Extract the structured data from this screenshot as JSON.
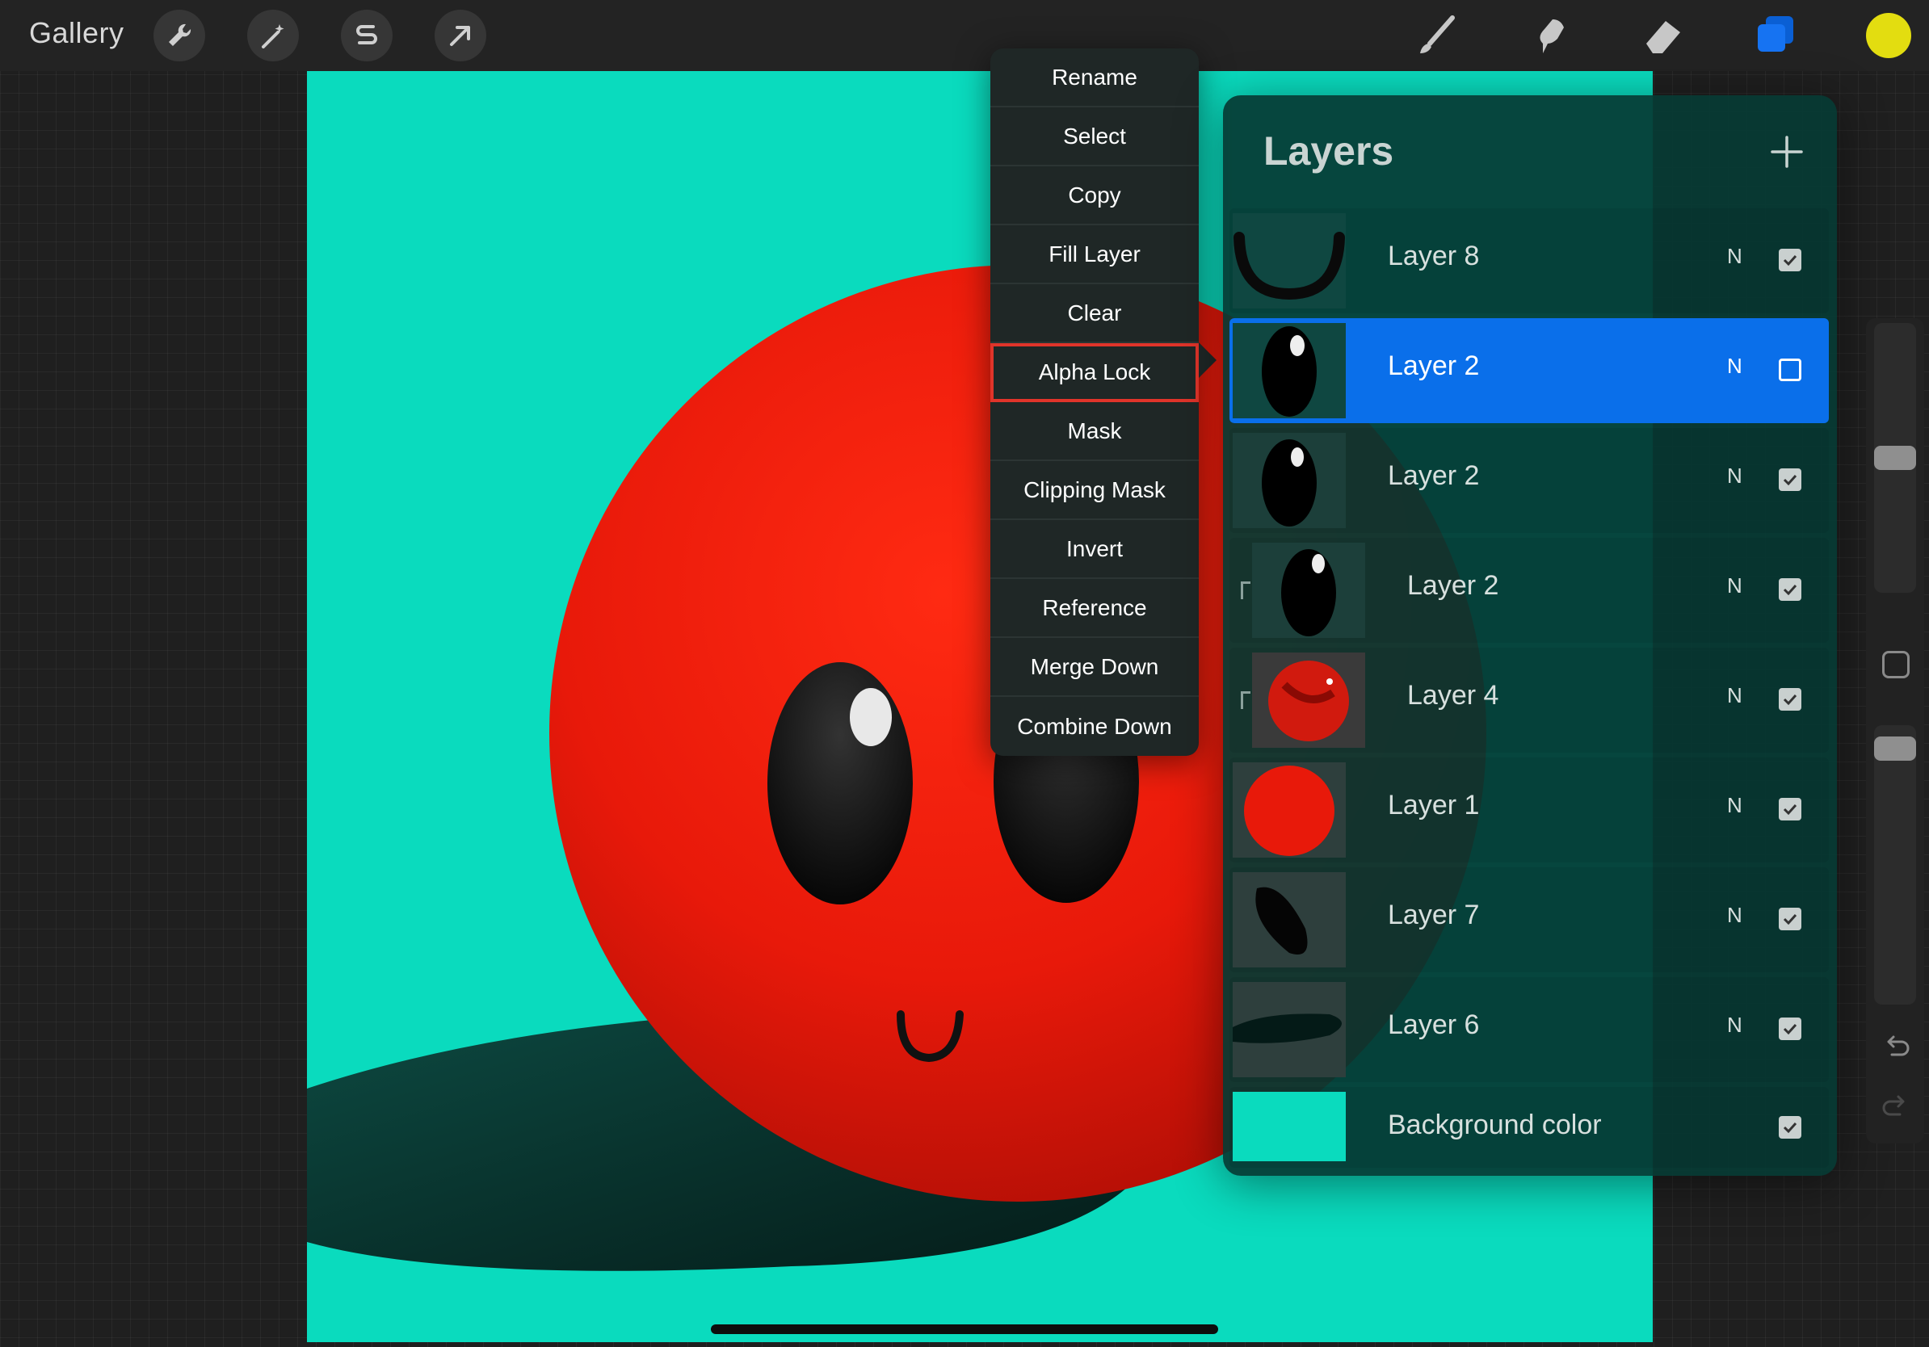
{
  "toolbar": {
    "gallery_label": "Gallery",
    "left_tools": [
      "wrench-icon",
      "magic-wand-icon",
      "selection-s-icon",
      "transform-arrow-icon"
    ],
    "right_tools": [
      "brush-icon",
      "smudge-icon",
      "eraser-icon",
      "layers-icon"
    ],
    "current_color": "#e3dd10"
  },
  "canvas": {
    "background": "#0adbbe",
    "subject": "red ball character with face and shadow"
  },
  "context_menu": {
    "items": [
      "Rename",
      "Select",
      "Copy",
      "Fill Layer",
      "Clear",
      "Alpha Lock",
      "Mask",
      "Clipping Mask",
      "Invert",
      "Reference",
      "Merge Down",
      "Combine Down"
    ],
    "highlighted": "Alpha Lock"
  },
  "layers_panel": {
    "title": "Layers",
    "layers": [
      {
        "name": "Layer 8",
        "blend": "N",
        "visible": true,
        "selected": false,
        "clipped": false,
        "thumb": "smile"
      },
      {
        "name": "Layer 2",
        "blend": "N",
        "visible": false,
        "selected": true,
        "clipped": false,
        "thumb": "eye"
      },
      {
        "name": "Layer 2",
        "blend": "N",
        "visible": true,
        "selected": false,
        "clipped": false,
        "thumb": "eye"
      },
      {
        "name": "Layer 2",
        "blend": "N",
        "visible": true,
        "selected": false,
        "clipped": true,
        "thumb": "eye"
      },
      {
        "name": "Layer 4",
        "blend": "N",
        "visible": true,
        "selected": false,
        "clipped": true,
        "thumb": "shade"
      },
      {
        "name": "Layer 1",
        "blend": "N",
        "visible": true,
        "selected": false,
        "clipped": false,
        "thumb": "ball"
      },
      {
        "name": "Layer 7",
        "blend": "N",
        "visible": true,
        "selected": false,
        "clipped": false,
        "thumb": "dark"
      },
      {
        "name": "Layer 6",
        "blend": "N",
        "visible": true,
        "selected": false,
        "clipped": false,
        "thumb": "shadow"
      },
      {
        "name": "Background color",
        "blend": "",
        "visible": true,
        "selected": false,
        "clipped": false,
        "thumb": "bg"
      }
    ]
  },
  "colors": {
    "accent": "#0a6fea",
    "canvas_bg": "#0adbbe",
    "ball_red": "#e8190a",
    "menu_highlight": "#e0342a"
  }
}
